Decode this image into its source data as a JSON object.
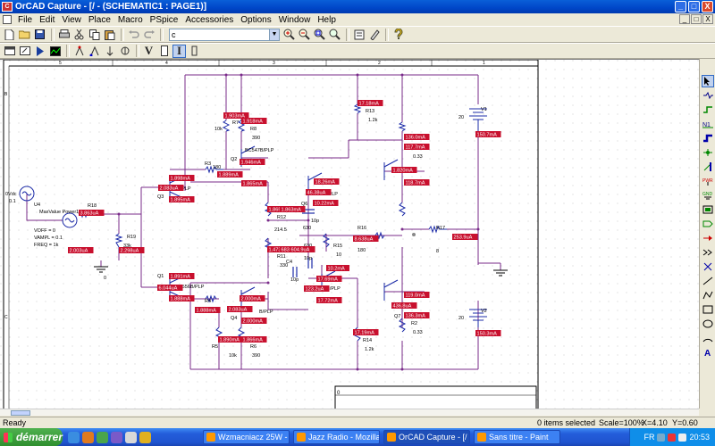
{
  "window": {
    "title": "OrCAD Capture - [/ - (SCHEMATIC1 : PAGE1)]",
    "app_icon_text": "C",
    "controls": [
      "_",
      "□",
      "X"
    ]
  },
  "menu": {
    "items": [
      "File",
      "Edit",
      "View",
      "Place",
      "Macro",
      "PSpice",
      "Accessories",
      "Options",
      "Window",
      "Help"
    ],
    "mdi_controls": [
      "_",
      "□",
      "X"
    ]
  },
  "toolbar": {
    "part_combo_value": "c",
    "icon_names": [
      "new-icon",
      "open-icon",
      "save-icon",
      "print-icon",
      "cut-icon",
      "copy-icon",
      "paste-icon",
      "undo-icon",
      "redo-icon"
    ],
    "zoom_icons": [
      "zoom-in-icon",
      "zoom-out-icon",
      "zoom-area-icon",
      "zoom-all-icon"
    ]
  },
  "toolbar2": {
    "text_buttons": [
      "V",
      "I"
    ]
  },
  "palette": {
    "tools": [
      "select",
      "part",
      "wire",
      "net-alias",
      "bus",
      "junction",
      "bus-entry",
      "power",
      "ground",
      "hierarchical-block",
      "port",
      "pin",
      "off-page",
      "no-connect",
      "line",
      "polyline",
      "rectangle",
      "ellipse",
      "arc",
      "text"
    ]
  },
  "schematic": {
    "ruler_top": [
      "5",
      "4",
      "3",
      "2",
      "1"
    ],
    "ruler_left": [
      "B",
      "C"
    ],
    "components": [
      {
        "ref": "V4",
        "label": "0Vdc"
      },
      {
        "ref": "V4_amp",
        "label": "0.1"
      },
      {
        "ref": "VOFF",
        "label": "VOFF = 0"
      },
      {
        "ref": "VAMPL",
        "label": "VAMPL = 0.1"
      },
      {
        "ref": "FREQ",
        "label": "FREQ = 1k"
      },
      {
        "ref": "R18",
        "label": "R18"
      },
      {
        "ref": "R19",
        "label": "R19"
      },
      {
        "ref": "R19v",
        "label": "33k"
      },
      {
        "ref": "R3",
        "label": "R3"
      },
      {
        "ref": "R3v",
        "label": "180"
      },
      {
        "ref": "R4",
        "label": "R4"
      },
      {
        "ref": "R5",
        "label": "R5"
      },
      {
        "ref": "R5v",
        "label": "10k"
      },
      {
        "ref": "R6",
        "label": "R6"
      },
      {
        "ref": "R6v",
        "label": "390"
      },
      {
        "ref": "R7",
        "label": "R7"
      },
      {
        "ref": "R8",
        "label": "R8"
      },
      {
        "ref": "R8v",
        "label": "390"
      },
      {
        "ref": "R9v",
        "label": "10k"
      },
      {
        "ref": "R12",
        "label": "R12"
      },
      {
        "ref": "R12v",
        "label": "214.5"
      },
      {
        "ref": "R11",
        "label": "R11"
      },
      {
        "ref": "R11v",
        "label": "330"
      },
      {
        "ref": "R13",
        "label": "R13"
      },
      {
        "ref": "R13v",
        "label": "1.2k"
      },
      {
        "ref": "R14",
        "label": "R14"
      },
      {
        "ref": "R14v",
        "label": "1.2k"
      },
      {
        "ref": "R15",
        "label": "R15"
      },
      {
        "ref": "R15v",
        "label": "10"
      },
      {
        "ref": "R16",
        "label": "R16"
      },
      {
        "ref": "R16v",
        "label": "180"
      },
      {
        "ref": "R17",
        "label": "R17"
      },
      {
        "ref": "R17v",
        "label": "8"
      },
      {
        "ref": "R1",
        "label": "R1"
      },
      {
        "ref": "R1v",
        "label": "0.33"
      },
      {
        "ref": "R2",
        "label": "R2"
      },
      {
        "ref": "R2v",
        "label": "0.33"
      },
      {
        "ref": "C3v",
        "label": "10p"
      },
      {
        "ref": "C4",
        "label": "C4"
      },
      {
        "ref": "C4v",
        "label": "10p"
      },
      {
        "ref": "C63",
        "label": "630"
      },
      {
        "ref": "C63b",
        "label": "630"
      },
      {
        "ref": "C10p",
        "label": "10p"
      },
      {
        "ref": "Q1",
        "label": "Q1"
      },
      {
        "ref": "Q2",
        "label": "Q2"
      },
      {
        "ref": "Q2m",
        "label": "BC547B/PLP"
      },
      {
        "ref": "Q3",
        "label": "Q3"
      },
      {
        "ref": "Q3m",
        "label": "B/PLP"
      },
      {
        "ref": "Q4",
        "label": "Q4"
      },
      {
        "ref": "Q4m",
        "label": "B/PLP"
      },
      {
        "ref": "Q1m",
        "label": "BC556B/PLP"
      },
      {
        "ref": "Q5m",
        "label": "/PLP"
      },
      {
        "ref": "Q6",
        "label": "Q6"
      },
      {
        "ref": "Q7",
        "label": "Q7"
      },
      {
        "ref": "Q8m",
        "label": "BD136/PLP"
      },
      {
        "ref": "V1",
        "label": "V1"
      },
      {
        "ref": "V1v",
        "label": "20"
      },
      {
        "ref": "V2",
        "label": "V2"
      },
      {
        "ref": "V2v",
        "label": "20"
      },
      {
        "ref": "U4",
        "label": "U4"
      },
      {
        "ref": "maxval",
        "label": "MaxValue Power1"
      },
      {
        "ref": "gnd0a",
        "label": "0"
      },
      {
        "ref": "gnd0b",
        "label": "0"
      },
      {
        "ref": "title_box",
        "label": "Title"
      }
    ],
    "probes": [
      {
        "id": "p1",
        "text": "1.903mA"
      },
      {
        "id": "p2",
        "text": "1.918mA"
      },
      {
        "id": "p3",
        "text": "1.946mA"
      },
      {
        "id": "p4",
        "text": "1.888mA"
      },
      {
        "id": "p5",
        "text": "1.889mA"
      },
      {
        "id": "p6",
        "text": "1.898mA"
      },
      {
        "id": "p7",
        "text": "2.083uA"
      },
      {
        "id": "p8",
        "text": "1.895mA"
      },
      {
        "id": "p9",
        "text": "1.865mA"
      },
      {
        "id": "p10",
        "text": "3.863uA"
      },
      {
        "id": "p11",
        "text": "2.003uA"
      },
      {
        "id": "p12",
        "text": "2.298uA"
      },
      {
        "id": "p13",
        "text": "1.891mA"
      },
      {
        "id": "p14",
        "text": "6.044uA"
      },
      {
        "id": "p15",
        "text": "1.888mA"
      },
      {
        "id": "p16",
        "text": "1.888mA"
      },
      {
        "id": "p17",
        "text": "2.000mA"
      },
      {
        "id": "p18",
        "text": "2.083uA"
      },
      {
        "id": "p19",
        "text": "2.000mA"
      },
      {
        "id": "p20",
        "text": "1.890mA"
      },
      {
        "id": "p21",
        "text": "1.866mA"
      },
      {
        "id": "p22",
        "text": "1.865mA"
      },
      {
        "id": "p23",
        "text": "1.863mA"
      },
      {
        "id": "p24",
        "text": "1.473mA"
      },
      {
        "id": "p25",
        "text": "683.9uA"
      },
      {
        "id": "p26",
        "text": "604.9uA"
      },
      {
        "id": "p27",
        "text": "46.38uA"
      },
      {
        "id": "p28",
        "text": "18.26mA"
      },
      {
        "id": "p29",
        "text": "10.22mA"
      },
      {
        "id": "p30",
        "text": "8.638uA"
      },
      {
        "id": "p31",
        "text": "17.18mA"
      },
      {
        "id": "p32",
        "text": "136.0mA"
      },
      {
        "id": "p33",
        "text": "117.7mA"
      },
      {
        "id": "p34",
        "text": "1.820mA"
      },
      {
        "id": "p35",
        "text": "118.7mA"
      },
      {
        "id": "p36",
        "text": "150.7mA"
      },
      {
        "id": "p37",
        "text": "253.9uA"
      },
      {
        "id": "p38",
        "text": "17.69mA"
      },
      {
        "id": "p39",
        "text": "123.2uA"
      },
      {
        "id": "p40",
        "text": "17.72mA"
      },
      {
        "id": "p41",
        "text": "119.0mA"
      },
      {
        "id": "p42",
        "text": "436.8uA"
      },
      {
        "id": "p43",
        "text": "136.3mA"
      },
      {
        "id": "p44",
        "text": "17.19mA"
      },
      {
        "id": "p45",
        "text": "150.3mA"
      },
      {
        "id": "p46",
        "text": "10.2mA"
      }
    ]
  },
  "status": {
    "ready": "Ready",
    "items_selected": "0 items selected",
    "scale": "Scale=100%",
    "x": "X=4.10",
    "y": "Y=0.60"
  },
  "taskbar": {
    "start_label": "démarrer",
    "tasks": [
      "Wzmacniacz 25W - A...",
      "Jazz Radio - Mozilla Fi...",
      "OrCAD Capture - [/ -...",
      "Sans titre - Paint"
    ],
    "tray_lang": "FR",
    "clock": "20:53"
  }
}
